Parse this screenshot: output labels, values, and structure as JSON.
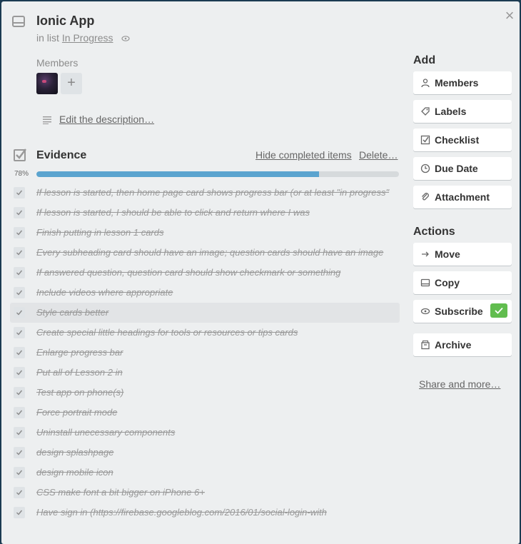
{
  "card": {
    "title": "Ionic App",
    "in_list_prefix": "in list",
    "list_name": "In Progress",
    "members_label": "Members",
    "add_member_symbol": "+",
    "close_symbol": "×",
    "description_link": "Edit the description…"
  },
  "checklist": {
    "title": "Evidence",
    "hide_completed": "Hide completed items",
    "delete": "Delete…",
    "progress_label": "78%",
    "progress_fraction": 0.78,
    "items": [
      "If lesson is started, then home page card shows progress bar (or at least \"in progress\"",
      "If lesson is started, I should be able to click and return where I was",
      "Finish putting in lesson 1 cards",
      "Every subheading card should have an image; question cards should have an image",
      "If answered question, question card should show checkmark or something",
      "Include videos where appropriate",
      "Style cards better",
      "Create special little headings for tools or resources or tips cards",
      "Enlarge progress bar",
      "Put all of Lesson 2 in",
      "Test app on phone(s)",
      "Force portrait mode",
      "Uninstall unecessary components",
      "design splashpage",
      "design mobile icon",
      "CSS make font a bit bigger on iPhone 6+",
      "Have sign in (https://firebase.googleblog.com/2016/01/social-login-with"
    ]
  },
  "sidebar": {
    "add_heading": "Add",
    "add_buttons": [
      {
        "label": "Members",
        "icon": "person-icon"
      },
      {
        "label": "Labels",
        "icon": "tag-icon"
      },
      {
        "label": "Checklist",
        "icon": "checklist-icon"
      },
      {
        "label": "Due Date",
        "icon": "clock-icon"
      },
      {
        "label": "Attachment",
        "icon": "paperclip-icon"
      }
    ],
    "actions_heading": "Actions",
    "action_buttons": [
      {
        "label": "Move",
        "icon": "arrow-right-icon"
      },
      {
        "label": "Copy",
        "icon": "card-icon"
      },
      {
        "label": "Subscribe",
        "icon": "eye-icon"
      },
      {
        "label": "Archive",
        "icon": "archive-icon"
      }
    ],
    "share_link": "Share and more…"
  },
  "colors": {
    "progress": "#5ba4cf",
    "subscribed": "#61bd4f"
  }
}
